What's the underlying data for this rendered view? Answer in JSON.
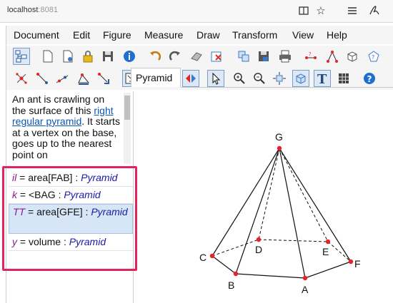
{
  "browser": {
    "url_host": "localhost",
    "url_port": ":8081",
    "icons": [
      "reader-view-icon",
      "star-icon",
      "menu-lines-icon",
      "pen-sign-icon"
    ]
  },
  "menubar": {
    "items": [
      "Document",
      "Edit",
      "Figure",
      "Measure",
      "Draw",
      "Transform",
      "View",
      "Help"
    ]
  },
  "toolbar_row1": [
    "select-mode-icon",
    "new-document-icon",
    "open-document-icon",
    "lock-icon",
    "save-icon",
    "info-icon",
    "undo-icon",
    "redo-icon",
    "eraser-icon",
    "delete-object-icon",
    "cube-group-icon",
    "save-figure-icon",
    "print-icon",
    "measure-length-icon",
    "measure-angle-icon",
    "cube-icon",
    "pentagon-icon"
  ],
  "toolbar_row2": [
    "point-tool-icon",
    "segment-tool-icon",
    "line-tool-icon",
    "polygon-tool-icon",
    "vector-tool-icon",
    "transform-tool-icon",
    "triangle-tool-icon",
    "reflect-tool-icon",
    "flip-tool-icon",
    "pointer-tool-icon",
    "zoom-in-icon",
    "zoom-out-icon",
    "move-view-icon",
    "rotate-view-icon",
    "text-tool-icon",
    "grid-icon",
    "help-icon"
  ],
  "description": {
    "text_before": "An ant is crawling on the surface of this ",
    "link": "right regular pyramid",
    "text_after": ". It starts at a vertex on the base, goes up to the nearest point on"
  },
  "objects": [
    {
      "var": "il",
      "expr": " = area[FAB] : ",
      "group": "Pyramid",
      "selected": false
    },
    {
      "var": "k",
      "expr": " = <BAG : ",
      "group": "Pyramid",
      "selected": false
    },
    {
      "var": "TT",
      "expr": " = area[GFE] : ",
      "group": "Pyramid",
      "selected": true
    },
    {
      "var": "y",
      "expr": " = volume : ",
      "group": "Pyramid",
      "selected": false
    }
  ],
  "tab": {
    "label": "Pyramid"
  },
  "figure": {
    "point_color": "#e8202a",
    "points": [
      "G",
      "C",
      "D",
      "E",
      "F",
      "B",
      "A"
    ]
  }
}
